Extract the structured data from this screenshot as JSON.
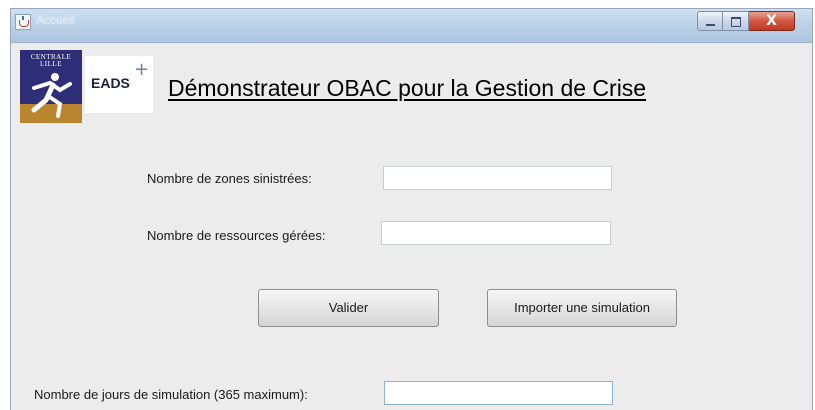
{
  "window": {
    "title": "Accueil",
    "controls": {
      "minimize_icon": "minimize-icon",
      "maximize_icon": "maximize-icon",
      "close_label": "X"
    }
  },
  "logos": {
    "centrale": {
      "line1": "CENTRALE",
      "line2": "LILLE"
    },
    "eads": {
      "text": "EADS",
      "plus": "+"
    }
  },
  "heading": "Démonstrateur OBAC pour la Gestion de Crise",
  "form": {
    "zones_label": "Nombre de zones sinistrées:",
    "zones_value": "",
    "resources_label": "Nombre de ressources gérées:",
    "resources_value": "",
    "days_label": "Nombre de jours de simulation (365 maximum):",
    "days_value": ""
  },
  "buttons": {
    "validate": "Valider",
    "import": "Importer une simulation"
  }
}
